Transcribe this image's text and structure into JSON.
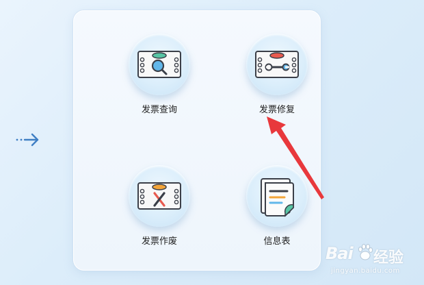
{
  "menu": {
    "items": [
      {
        "label": "发票查询",
        "icon": "invoice-search-icon"
      },
      {
        "label": "发票修复",
        "icon": "invoice-repair-icon"
      },
      {
        "label": "发票作废",
        "icon": "invoice-void-icon"
      },
      {
        "label": "信息表",
        "icon": "info-sheet-icon"
      }
    ]
  },
  "nav": {
    "icon": "arrow-right-icon"
  },
  "annotation": {
    "icon": "red-pointer-arrow",
    "color": "#e8383c"
  },
  "watermark": {
    "brand": "Bai",
    "brand_suffix": "经验",
    "url": "jingyan.baidu.com"
  },
  "colors": {
    "accent_blue": "#3f7fc4",
    "annotation_red": "#e8383c",
    "green_pill": "#57c4a4",
    "red_pill": "#e85a4f",
    "orange_pill": "#f3a53a"
  }
}
